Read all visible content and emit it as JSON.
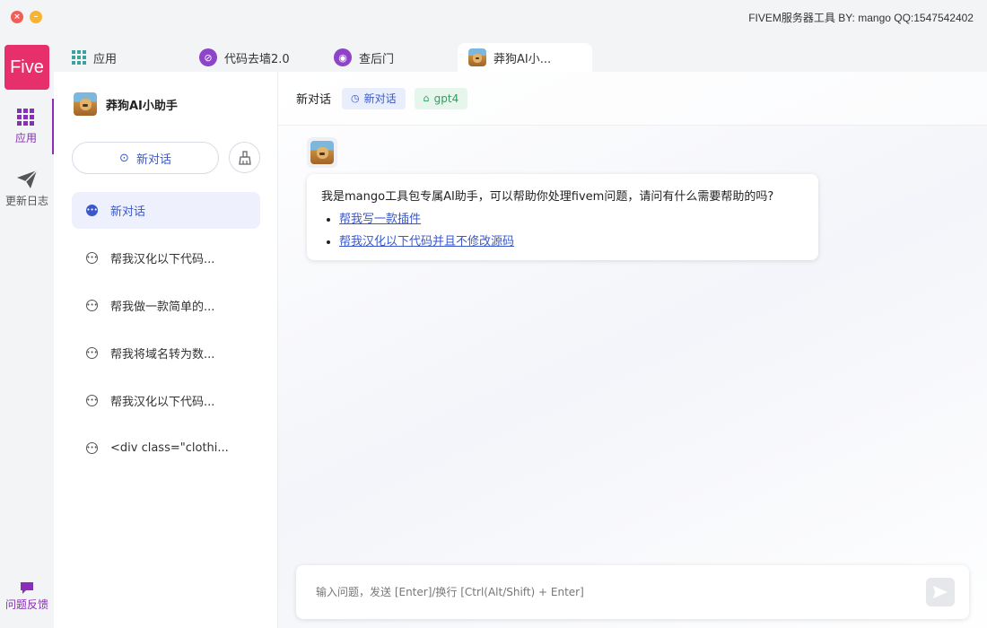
{
  "window": {
    "title": "FIVEM服务器工具 BY: mango QQ:1547542402",
    "close_icon": "×",
    "min_icon": "–"
  },
  "rail": {
    "logo": "Five",
    "items": [
      {
        "label": "应用",
        "icon": "grid-icon"
      },
      {
        "label": "更新日志",
        "icon": "paper-plane-icon"
      }
    ],
    "feedback_label": "问题反馈"
  },
  "tabs": [
    {
      "label": "应用",
      "icon": "grid-icon"
    },
    {
      "label": "代码去墙2.0",
      "icon": "code-unlock-icon",
      "color": "#8e44c9"
    },
    {
      "label": "查后门",
      "icon": "fingerprint-icon",
      "color": "#8e44c9"
    },
    {
      "label": "莽狗AI小...",
      "icon": "avatar-icon"
    }
  ],
  "sidebar": {
    "title": "莽狗AI小助手",
    "new_chat_label": "新对话",
    "conversations": [
      "新对话",
      "帮我汉化以下代码...",
      "帮我做一款简单的...",
      "帮我将域名转为数...",
      "帮我汉化以下代码...",
      "<div class=\"clothi..."
    ]
  },
  "chat": {
    "title": "新对话",
    "tag_conversation": "新对话",
    "tag_model": "gpt4",
    "message": "我是mango工具包专属AI助手，可以帮助你处理fivem问题，请问有什么需要帮助的吗?",
    "suggestions": [
      "帮我写一款插件",
      "帮我汉化以下代码并且不修改源码"
    ],
    "input_placeholder": "输入问题，发送 [Enter]/换行 [Ctrl(Alt/Shift) + Enter]"
  },
  "colors": {
    "accent": "#3a58c9",
    "brand": "#e72f6c",
    "rail_active": "#8a2db8",
    "tag_green": "#2f9e5d"
  }
}
